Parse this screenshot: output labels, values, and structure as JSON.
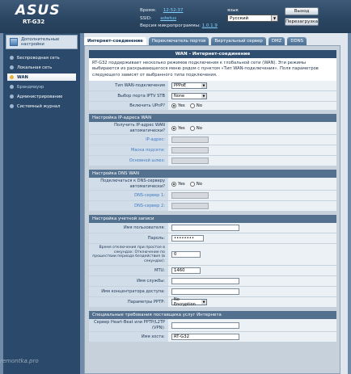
{
  "header": {
    "brand": "ASUS",
    "model": "RT-G32",
    "time_label": "Время:",
    "time_value": "12:52:37",
    "ssid_label": "SSID:",
    "ssid_value": "adwtus",
    "fw_label": "Версия микропрограммы:",
    "fw_value": "1.0.1.9",
    "lang_label": "язык",
    "lang_value": "Русский",
    "logout_label": "Выход",
    "reboot_label": "Перезагрузка"
  },
  "sidebar": {
    "top_label": "Дополнительные настройки",
    "items": [
      {
        "label": "Беспроводная сеть"
      },
      {
        "label": "Локальная сеть"
      },
      {
        "label": "WAN"
      },
      {
        "label": "Брандмауэр"
      },
      {
        "label": "Администрирование"
      },
      {
        "label": "Системный журнал"
      }
    ]
  },
  "tabs": [
    {
      "label": "Интернет-соединение"
    },
    {
      "label": "Переключатель портов"
    },
    {
      "label": "Виртуальный сервер"
    },
    {
      "label": "DMZ"
    },
    {
      "label": "DDNS"
    }
  ],
  "panel": {
    "title": "WAN - Интернет-соединение",
    "description": "RT-G32 поддерживает несколько режимов подключения к глобальной сети (WAN). Эти режимы выбираются из раскрывающегося меню рядом с пунктом «Тип WAN-подключения». Поля параметров следующего зависят от выбранного типа подключения."
  },
  "basic": {
    "wan_type_label": "Тип WAN-подключения",
    "wan_type_value": "PPPoE",
    "iptv_label": "Выбор порта IPTV STB",
    "iptv_value": "None",
    "upnp_label": "Включить UPnP?",
    "yes": "Yes",
    "no": "No"
  },
  "ip_section": {
    "title": "Настройка IP-адреса WAN",
    "auto_ip_label": "Получить IP-адрес WAN автоматически?",
    "ip_label": "IP-адрес:",
    "mask_label": "Маска подсети:",
    "gateway_label": "Основной шлюз:"
  },
  "dns_section": {
    "title": "Настройка DNS WAN",
    "auto_dns_label": "Подключаться к DNS-серверу автоматически?",
    "dns1_label": "DNS-сервер 1:",
    "dns2_label": "DNS-сервер 2:"
  },
  "account_section": {
    "title": "Настройка учетной записи",
    "username_label": "Имя пользователя:",
    "username_value": "",
    "password_label": "Пароль:",
    "password_value": "••••••••",
    "idle_label": "Время отключения при простое в секундах: Отключение по прошествии периода бездействия (в секундах):",
    "idle_value": "0",
    "mtu_label": "MTU:",
    "mtu_value": "1460",
    "service_label": "Имя службы:",
    "concentrator_label": "Имя концентратора доступа:",
    "pptp_label": "Параметры PPTP:",
    "pptp_value": "No Encryption"
  },
  "isp_section": {
    "title": "Специальные требования поставщика услуг Интернета",
    "heartbeat_label": "Сервер Heart-Beat или PPTP/L2TP (VPN):",
    "host_label": "Имя хоста:",
    "host_value": "RT-G32"
  },
  "watermark": "remontka.pro"
}
